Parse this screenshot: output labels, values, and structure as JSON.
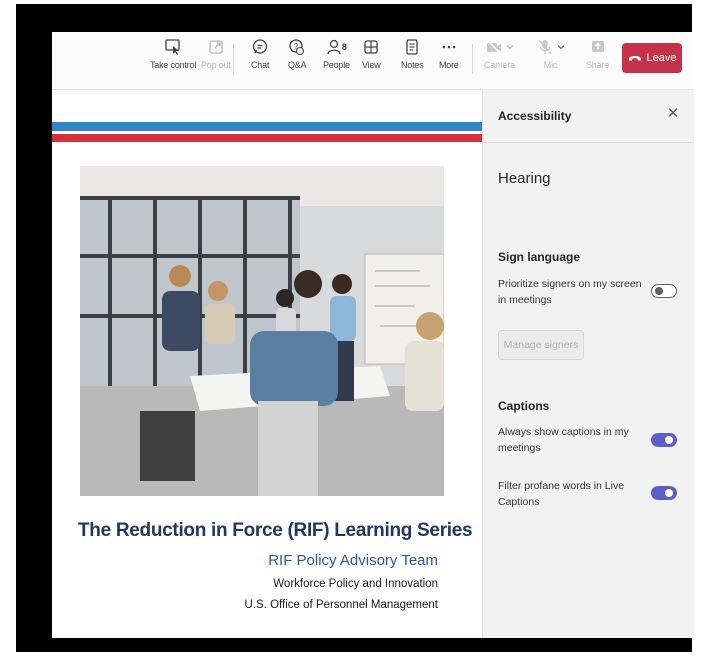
{
  "toolbar": {
    "take_control": "Take control",
    "pop_out": "Pop out",
    "chat": "Chat",
    "qa": "Q&A",
    "people": "People",
    "people_count": "8",
    "view": "View",
    "notes": "Notes",
    "more": "More",
    "camera": "Camera",
    "mic": "Mic",
    "share": "Share",
    "leave": "Leave"
  },
  "slide": {
    "title": "The Reduction in Force (RIF) Learning Series",
    "subtitle": "RIF Policy Advisory Team",
    "line3": "Workforce Policy and Innovation",
    "line4": "U.S. Office of Personnel Management"
  },
  "panel": {
    "title": "Accessibility",
    "hearing": "Hearing",
    "sign_language": "Sign language",
    "prioritize_signers": "Prioritize signers on my screen in meetings",
    "prioritize_signers_on": false,
    "manage_signers": "Manage signers",
    "captions": "Captions",
    "always_show_captions": "Always show captions in my meetings",
    "always_show_captions_on": true,
    "filter_profane": "Filter profane words in Live Captions",
    "filter_profane_on": true
  },
  "colors": {
    "leave_red": "#c4314b",
    "toggle_on": "#5b5fc7",
    "title_navy": "#1f3864",
    "subtitle_blue": "#2f5597"
  }
}
